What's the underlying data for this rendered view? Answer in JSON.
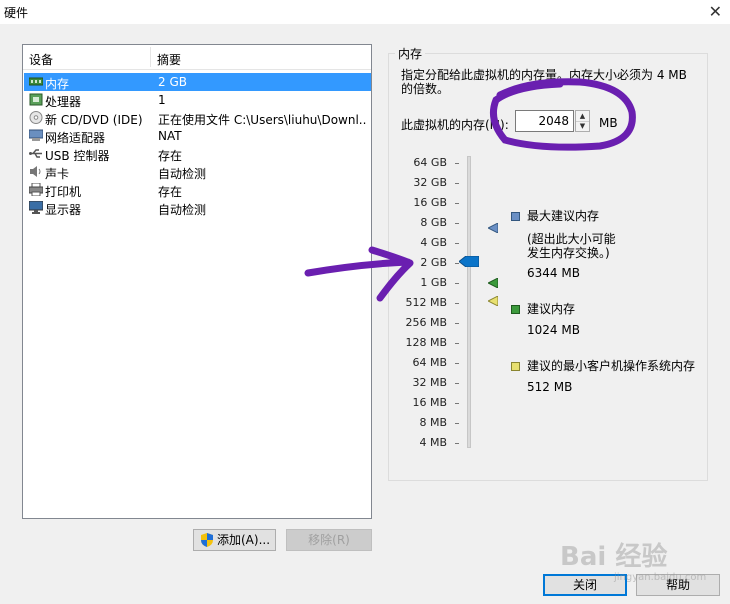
{
  "window": {
    "title": "硬件"
  },
  "device_list": {
    "headers": {
      "device": "设备",
      "summary": "摘要"
    },
    "rows": [
      {
        "name": "内存",
        "summary": "2 GB",
        "icon": "memory-icon",
        "selected": true
      },
      {
        "name": "处理器",
        "summary": "1",
        "icon": "processor-icon",
        "selected": false
      },
      {
        "name": "新 CD/DVD (IDE)",
        "summary": "正在使用文件 C:\\Users\\liuhu\\Downl...",
        "icon": "cd-dvd-icon",
        "selected": false
      },
      {
        "name": "网络适配器",
        "summary": "NAT",
        "icon": "network-adapter-icon",
        "selected": false
      },
      {
        "name": "USB 控制器",
        "summary": "存在",
        "icon": "usb-icon",
        "selected": false
      },
      {
        "name": "声卡",
        "summary": "自动检测",
        "icon": "sound-card-icon",
        "selected": false
      },
      {
        "name": "打印机",
        "summary": "存在",
        "icon": "printer-icon",
        "selected": false
      },
      {
        "name": "显示器",
        "summary": "自动检测",
        "icon": "display-icon",
        "selected": false
      }
    ]
  },
  "buttons": {
    "add": "添加(A)...",
    "remove": "移除(R)",
    "close": "关闭",
    "help": "帮助"
  },
  "memory": {
    "group_title": "内存",
    "description": "指定分配给此虚拟机的内存量。内存大小必须为 4 MB 的倍数。",
    "label": "此虚拟机的内存(M):",
    "value": "2048",
    "unit": "MB",
    "scale": [
      "64 GB",
      "32 GB",
      "16 GB",
      "8 GB",
      "4 GB",
      "2 GB",
      "1 GB",
      "512 MB",
      "256 MB",
      "128 MB",
      "64 MB",
      "32 MB",
      "16 MB",
      "8 MB",
      "4 MB"
    ],
    "current_level": "2 GB",
    "legend": {
      "max": {
        "title": "最大建议内存",
        "note_line1": "(超出此大小可能",
        "note_line2": "发生内存交换。)",
        "value": "6344 MB",
        "color": "#6a8fc4"
      },
      "recommended": {
        "title": "建议内存",
        "value": "1024 MB",
        "color": "#3c9a3c"
      },
      "min": {
        "title": "建议的最小客户机操作系统内存",
        "value": "512 MB",
        "color": "#e8e070"
      }
    }
  },
  "watermark": {
    "text": "Bai 经验",
    "sub": "jingyan.baidu.com"
  },
  "annotation_color": "#6a1fb0"
}
